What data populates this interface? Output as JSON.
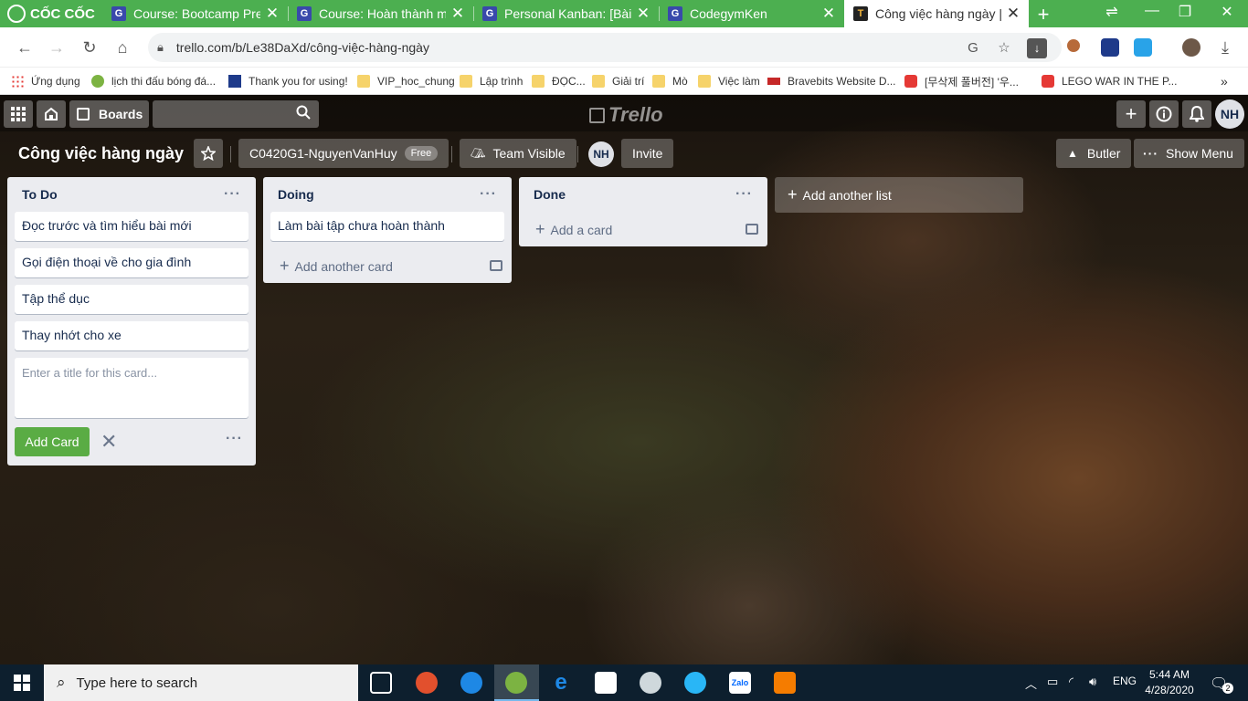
{
  "browser": {
    "brand": "CỐC CỐC",
    "tabs": [
      {
        "title": "Course: Bootcamp Prep",
        "favicon": "G"
      },
      {
        "title": "Course: Hoàn thành mọ",
        "favicon": "G"
      },
      {
        "title": "Personal Kanban: [Bài tậ",
        "favicon": "G"
      },
      {
        "title": "CodegymKen",
        "favicon": "G"
      },
      {
        "title": "Công việc hàng ngày | T",
        "favicon": "T"
      }
    ],
    "url": "trello.com/b/Le38DaXd/công-việc-hàng-ngày",
    "bookmarks": [
      {
        "label": "Ứng dụng",
        "icon": "apps"
      },
      {
        "label": "lịch thi đấu bóng đá...",
        "icon": "globe"
      },
      {
        "label": "Thank you for using!",
        "icon": "j-logo"
      },
      {
        "label": "VIP_hoc_chung",
        "icon": "folder"
      },
      {
        "label": "Lập trình",
        "icon": "folder"
      },
      {
        "label": "ĐỌC...",
        "icon": "folder"
      },
      {
        "label": "Giải trí",
        "icon": "folder"
      },
      {
        "label": "Mò",
        "icon": "folder"
      },
      {
        "label": "Việc làm",
        "icon": "folder"
      },
      {
        "label": "Bravebits Website D...",
        "icon": "bravebits"
      },
      {
        "label": "[무삭제 풀버전] '우...",
        "icon": "youtube"
      },
      {
        "label": "LEGO WAR IN THE P...",
        "icon": "youtube"
      }
    ],
    "more_bookmarks": "»"
  },
  "trello": {
    "boards_label": "Boards",
    "logo_text": "Trello",
    "user_initials": "NH",
    "board_title": "Công việc hàng ngày",
    "team_name": "C0420G1-NguyenVanHuy",
    "team_badge": "Free",
    "visibility": "Team Visible",
    "member_initials": "NH",
    "invite_label": "Invite",
    "butler_label": "Butler",
    "show_menu_label": "Show Menu",
    "lists": [
      {
        "name": "To Do",
        "cards": [
          "Đọc trước và tìm hiểu bài mới",
          "Gọi điện thoại về cho gia đình",
          "Tập thể dục",
          "Thay nhớt cho xe"
        ],
        "composer_placeholder": "Enter a title for this card...",
        "add_button": "Add Card"
      },
      {
        "name": "Doing",
        "cards": [
          "Làm bài tập chưa hoàn thành"
        ],
        "add_label": "Add another card"
      },
      {
        "name": "Done",
        "cards": [],
        "add_label": "Add a card"
      }
    ],
    "add_list_label": "Add another list"
  },
  "taskbar": {
    "search_placeholder": "Type here to search",
    "language": "ENG",
    "time": "5:44 AM",
    "date": "4/28/2020",
    "notification_count": "2"
  }
}
